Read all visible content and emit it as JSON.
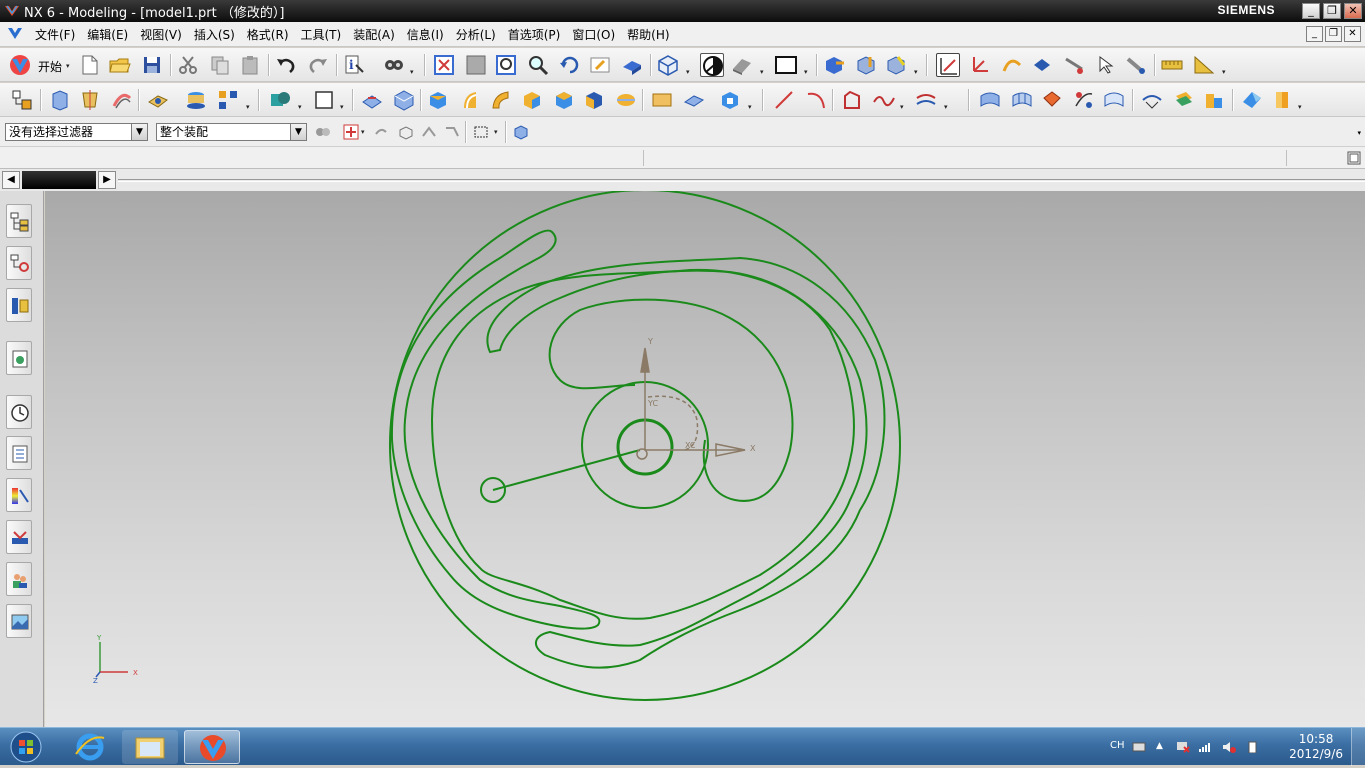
{
  "window": {
    "title": "NX 6 - Modeling - [model1.prt （修改的）]",
    "brand": "SIEMENS",
    "controls": {
      "minimize": "_",
      "maximize": "❐",
      "close": "✕"
    }
  },
  "menu": {
    "items": [
      "文件(F)",
      "编辑(E)",
      "视图(V)",
      "插入(S)",
      "格式(R)",
      "工具(T)",
      "装配(A)",
      "信息(I)",
      "分析(L)",
      "首选项(P)",
      "窗口(O)",
      "帮助(H)"
    ]
  },
  "toolbar": {
    "start_label": "开始"
  },
  "selection": {
    "filter_value": "没有选择过滤器",
    "scope_value": "整个装配"
  },
  "triad": {
    "x": "X",
    "y": "Y",
    "z": "Z"
  },
  "csys": {
    "x": "X",
    "y": "Y",
    "xc": "XC",
    "yc": "YC"
  },
  "taskbar": {
    "lang": "CH",
    "time": "10:58",
    "date": "2012/9/6"
  },
  "colors": {
    "sketch_curve": "#1a8a1a",
    "csys": "#8a7a66",
    "titlebar": "#1a1a1a",
    "taskbar": "#3b6ea3"
  }
}
